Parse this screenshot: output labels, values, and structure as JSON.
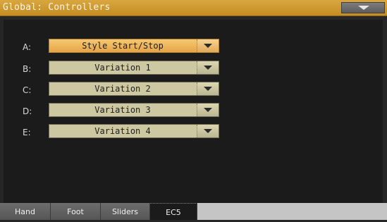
{
  "header": {
    "title": "Global: Controllers",
    "menu_icon": "triangle-down-icon"
  },
  "controllers": [
    {
      "label": "A:",
      "value": "Style Start/Stop",
      "selected": true
    },
    {
      "label": "B:",
      "value": "Variation 1",
      "selected": false
    },
    {
      "label": "C:",
      "value": "Variation 2",
      "selected": false
    },
    {
      "label": "D:",
      "value": "Variation 3",
      "selected": false
    },
    {
      "label": "E:",
      "value": "Variation 4",
      "selected": false
    }
  ],
  "tabs": [
    {
      "label": "Hand",
      "active": false
    },
    {
      "label": "Foot",
      "active": false
    },
    {
      "label": "Sliders",
      "active": false
    },
    {
      "label": "EC5",
      "active": true
    }
  ],
  "colors": {
    "title_bar": "#c58d23",
    "selected_field": "#f0b85c",
    "field": "#cdc8a2",
    "panel": "#1b1b1b"
  }
}
